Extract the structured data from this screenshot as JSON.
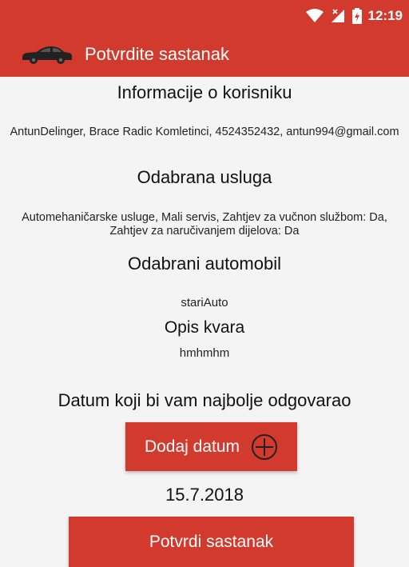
{
  "status": {
    "time": "12:19"
  },
  "appbar": {
    "title": "Potvrdite sastanak",
    "icon": "car-icon"
  },
  "user_section": {
    "heading": "Informacije o korisniku",
    "text": "AntunDelinger, Brace Radic Komletinci, 4524352432, antun994@gmail.com"
  },
  "service_section": {
    "heading": "Odabrana usluga",
    "text": "Automehaničarske usluge, Mali servis, Zahtjev za vučnon službom: Da, Zahtjev za naručivanjem dijelova: Da"
  },
  "car_section": {
    "heading": "Odabrani automobil",
    "value": "stariAuto"
  },
  "fault_section": {
    "heading": "Opis kvara",
    "value": "hmhmhm"
  },
  "date_section": {
    "heading": "Datum koji bi vam najbolje odgovarao",
    "add_button_label": "Dodaj datum",
    "selected_date": "15.7.2018"
  },
  "confirm_button": {
    "label": "Potvrdi sastanak"
  },
  "colors": {
    "accent": "#d23a2d",
    "background": "#f4f4f4"
  }
}
